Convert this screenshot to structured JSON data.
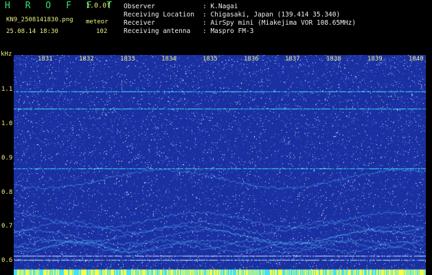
{
  "header": {
    "title": "H R O F F T",
    "version": "1.0.0f",
    "filename": "KN9_2508141830.png",
    "datetime": "25.08.14 18:30",
    "meteor_label": "meteor",
    "meteor_count": "102"
  },
  "info": [
    {
      "label": "Observer",
      "value": "K.Nagai"
    },
    {
      "label": "Receiving Location",
      "value": "Chigasaki, Japan (139.414 35.340)"
    },
    {
      "label": "Receiver",
      "value": "AirSpy mini (Miakejima VOR 108.65MHz)"
    },
    {
      "label": "Receiving antenna",
      "value": "Maspro FM-3"
    }
  ],
  "axis": {
    "y_unit": "kHz",
    "y_ticks": [
      "1.1",
      "1.0",
      "0.9",
      "0.8",
      "0.7",
      "0.6"
    ],
    "x_ticks": [
      "1831",
      "1832",
      "1833",
      "1834",
      "1835",
      "1836",
      "1837",
      "1838",
      "1839",
      "1840"
    ]
  },
  "colors": {
    "background": "#1a2fa0",
    "noise": "#ffffff",
    "signal": "#3ee7ff",
    "text": "#f0f080",
    "title": "#34e36b"
  },
  "signals_khz": [
    1.095,
    1.045,
    0.87,
    0.617,
    0.604
  ]
}
